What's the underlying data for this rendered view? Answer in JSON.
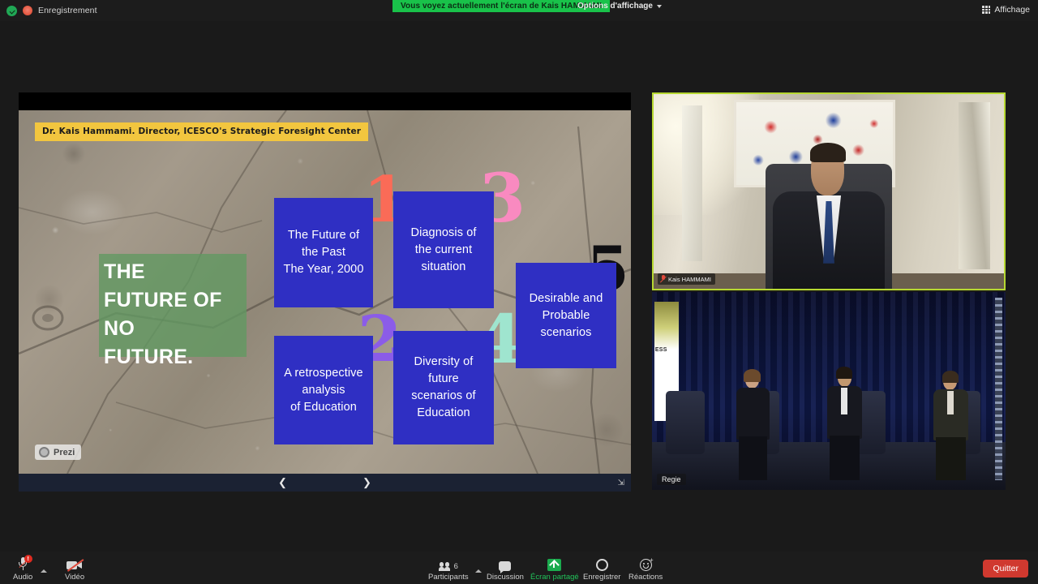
{
  "topbar": {
    "security_icon": "shield-check-icon",
    "recording_icon": "recording-indicator-icon",
    "recording_label": "Enregistrement",
    "share_banner": "Vous voyez actuellement l'écran de Kais HAMMAMI",
    "display_options_label": "Options d'affichage",
    "view_icon": "grid-view-icon",
    "view_label": "Affichage"
  },
  "share": {
    "credit_bar": "Dr. Kais Hammami. Director, ICESCO's Strategic Foresight Center",
    "hero_lines": "THE\nFUTURE OF\nNO\nFUTURE.",
    "watermark": "Prezi",
    "watermark_icon": "prezi-logo-icon",
    "controls": {
      "prev_icon": "chevron-left-icon",
      "next_icon": "chevron-right-icon",
      "fullscreen_icon": "expand-arrows-icon"
    },
    "numbers": [
      {
        "text": "1",
        "color": "#fa6b57"
      },
      {
        "text": "2",
        "color": "#8b5ce8"
      },
      {
        "text": "3",
        "color": "#f98ac0"
      },
      {
        "text": "4",
        "color": "#9fe5cf"
      },
      {
        "text": "5",
        "color": "#0f0f12"
      }
    ],
    "cards": [
      {
        "id": "card-1",
        "text": "The Future of\nthe Past\nThe Year, 2000"
      },
      {
        "id": "card-2",
        "text": "Diagnosis of\nthe current\nsituation"
      },
      {
        "id": "card-3",
        "text": "A retrospective\nanalysis\nof Education"
      },
      {
        "id": "card-4",
        "text": "Diversity of\nfuture\nscenarios of\nEducation"
      },
      {
        "id": "card-5",
        "text": "Desirable and\nProbable\nscenarios"
      }
    ],
    "card_color": "#2f2fc3",
    "highlight_color": "#619861"
  },
  "videos": [
    {
      "id": "tile-speaker",
      "name": "Kais HAMMAMI",
      "mic_icon": "mic-muted-icon",
      "active_border": "#b7d832"
    },
    {
      "id": "tile-room",
      "name": "Regie",
      "banner_text": "ESS"
    }
  ],
  "toolbar": {
    "audio": {
      "icon": "microphone-muted-icon",
      "label": "Audio",
      "alert": "!",
      "chevron": "chevron-up-icon"
    },
    "video": {
      "icon": "camera-off-icon",
      "label": "Vidéo"
    },
    "participants": {
      "icon": "participants-icon",
      "label": "Participants",
      "count": "6",
      "chevron": "chevron-up-icon"
    },
    "chat": {
      "icon": "chat-bubble-icon",
      "label": "Discussion"
    },
    "share_screen": {
      "icon": "share-screen-icon",
      "label": "Écran partagé",
      "color": "#21c25a"
    },
    "record": {
      "icon": "record-circle-icon",
      "label": "Enregistrer"
    },
    "reactions": {
      "icon": "reactions-smiley-icon",
      "label": "Réactions"
    },
    "leave": {
      "label": "Quitter",
      "color": "#d0392f"
    }
  }
}
